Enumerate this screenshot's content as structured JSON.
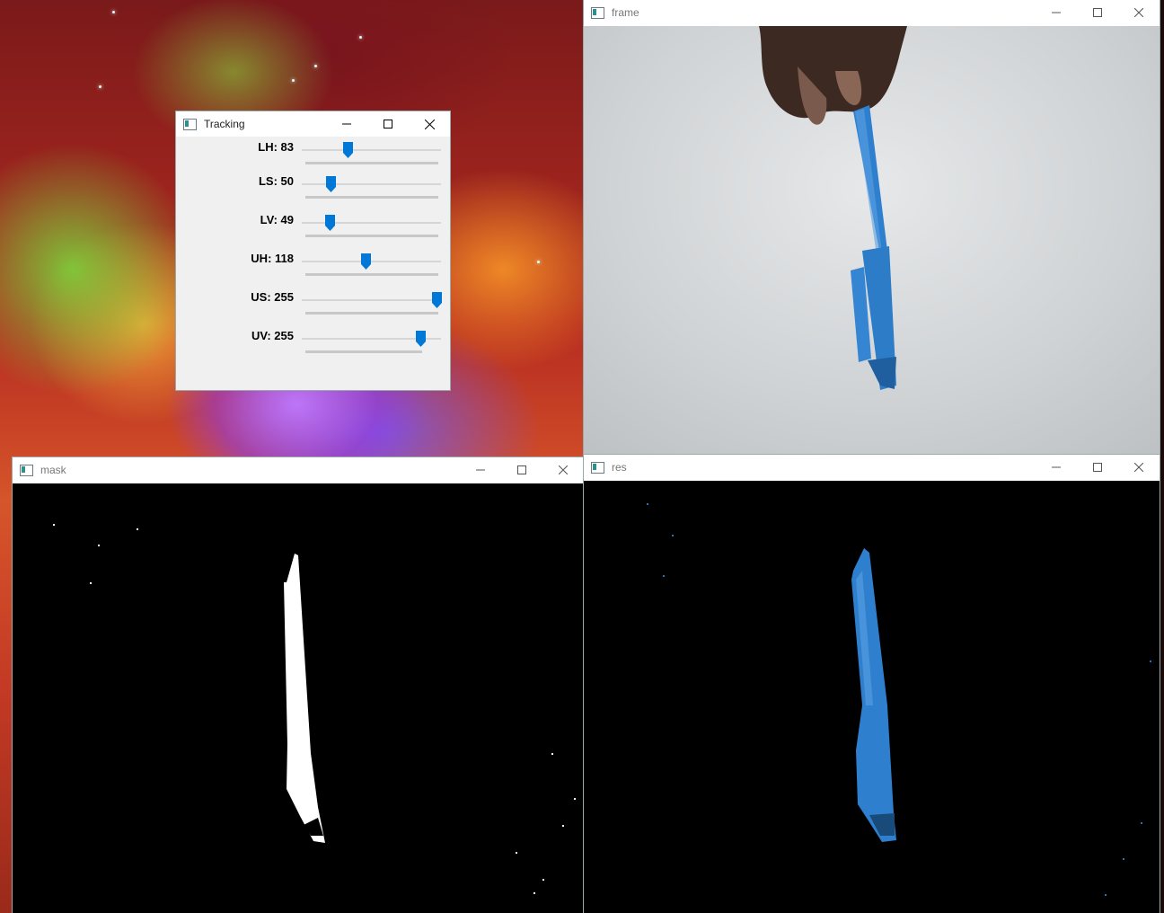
{
  "windows": {
    "tracking": {
      "title": "Tracking",
      "trackbars": [
        {
          "label": "LH: 83",
          "name": "LH",
          "value": 83,
          "max": 179
        },
        {
          "label": "LS: 50",
          "name": "LS",
          "value": 50,
          "max": 255
        },
        {
          "label": "LV: 49",
          "name": "LV",
          "value": 49,
          "max": 255
        },
        {
          "label": "UH: 118",
          "name": "UH",
          "value": 118,
          "max": 255
        },
        {
          "label": "US: 255",
          "name": "US",
          "value": 255,
          "max": 255
        },
        {
          "label": "UV: 255",
          "name": "UV",
          "value": 255,
          "max": 255
        }
      ]
    },
    "frame": {
      "title": "frame"
    },
    "mask": {
      "title": "mask"
    },
    "res": {
      "title": "res"
    }
  },
  "colors": {
    "thumb": "#0078d7",
    "pen_blue": "#2f7fcf",
    "mask_white": "#ffffff",
    "background_black": "#000000"
  },
  "icons": [
    "app-icon",
    "minimize-icon",
    "maximize-icon",
    "close-icon"
  ]
}
